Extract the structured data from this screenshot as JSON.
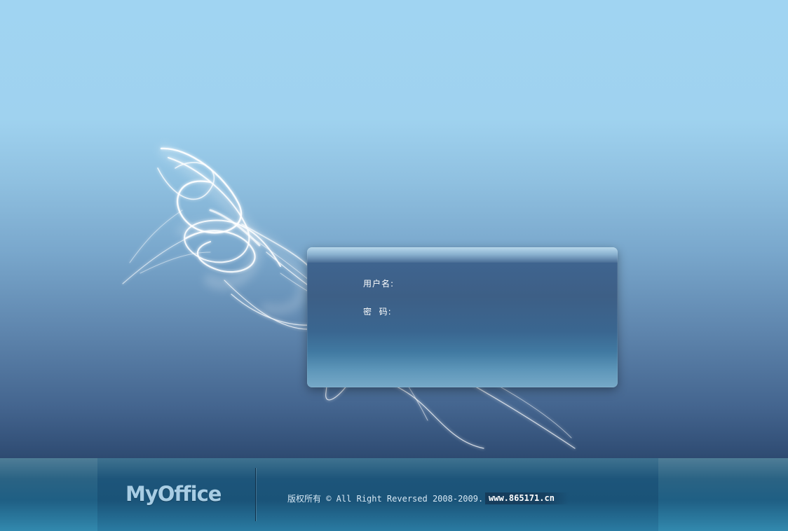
{
  "login": {
    "username_label": "用户名:",
    "password_label": "密  码:",
    "username_value": "",
    "password_value": ""
  },
  "footer": {
    "logo_text": "MyOffice",
    "copyright": "版权所有 © All Right Reversed 2008-2009.",
    "site": "www.865171.cn"
  },
  "colors": {
    "background_top": "#a0d4f2",
    "background_bottom": "#2d4a70",
    "panel": "#3d5f86",
    "footer": "#1d557a",
    "logo": "#a8cde4"
  }
}
